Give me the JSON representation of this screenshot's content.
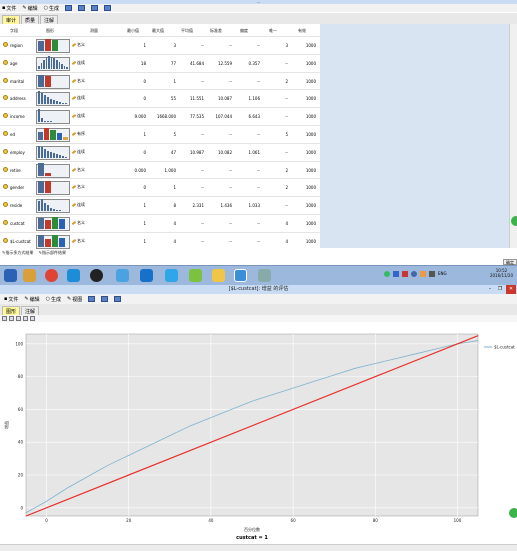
{
  "window1": {
    "title": "…",
    "menu": [
      {
        "label": "文件"
      },
      {
        "label": "编辑"
      },
      {
        "label": "生成"
      }
    ],
    "tabs": [
      {
        "label": "审计",
        "active": true
      },
      {
        "label": "质量",
        "active": false
      },
      {
        "label": "注解",
        "active": false
      }
    ],
    "columns": [
      "字段",
      "图形",
      "测量",
      "最小值",
      "最大值",
      "平均值",
      "标准差",
      "偏度",
      "唯一",
      "有效"
    ],
    "rows": [
      {
        "field": "region",
        "measure": "名义",
        "min": "1",
        "max": "3",
        "mean": "--",
        "sd": "--",
        "skew": "--",
        "unique": "3",
        "valid": "1000",
        "chart": "cat",
        "bars": [
          10,
          12,
          11
        ]
      },
      {
        "field": "age",
        "measure": "连续",
        "min": "18",
        "max": "77",
        "mean": "41.684",
        "sd": "12.559",
        "skew": "0.357",
        "unique": "--",
        "valid": "1000",
        "chart": "hist",
        "bars": [
          3,
          6,
          9,
          12,
          13,
          12,
          11,
          9,
          7,
          5,
          3,
          2
        ]
      },
      {
        "field": "marital",
        "measure": "名义",
        "min": "0",
        "max": "1",
        "mean": "--",
        "sd": "--",
        "skew": "--",
        "unique": "2",
        "valid": "1000",
        "chart": "cat",
        "bars": [
          12,
          11
        ]
      },
      {
        "field": "address",
        "measure": "连续",
        "min": "0",
        "max": "55",
        "mean": "11.551",
        "sd": "10.087",
        "skew": "1.106",
        "unique": "--",
        "valid": "1000",
        "chart": "hist",
        "bars": [
          13,
          11,
          9,
          7,
          5,
          4,
          3,
          2,
          1,
          1
        ]
      },
      {
        "field": "income",
        "measure": "连续",
        "min": "9.000",
        "max": "1668.000",
        "mean": "77.535",
        "sd": "107.044",
        "skew": "6.643",
        "unique": "--",
        "valid": "1000",
        "chart": "hist",
        "bars": [
          13,
          4,
          1,
          1,
          1
        ]
      },
      {
        "field": "ed",
        "measure": "有序",
        "min": "1",
        "max": "5",
        "mean": "--",
        "sd": "--",
        "skew": "--",
        "unique": "5",
        "valid": "1000",
        "chart": "cat",
        "bars": [
          8,
          12,
          10,
          7,
          3
        ]
      },
      {
        "field": "employ",
        "measure": "连续",
        "min": "0",
        "max": "47",
        "mean": "10.987",
        "sd": "10.082",
        "skew": "1.061",
        "unique": "--",
        "valid": "1000",
        "chart": "hist",
        "bars": [
          12,
          11,
          9,
          7,
          6,
          5,
          4,
          3,
          2,
          1
        ]
      },
      {
        "field": "retire",
        "measure": "名义",
        "min": "0.000",
        "max": "1.000",
        "mean": "--",
        "sd": "--",
        "skew": "--",
        "unique": "2",
        "valid": "1000",
        "chart": "cat",
        "bars": [
          13,
          3
        ]
      },
      {
        "field": "gender",
        "measure": "名义",
        "min": "0",
        "max": "1",
        "mean": "--",
        "sd": "--",
        "skew": "--",
        "unique": "2",
        "valid": "1000",
        "chart": "cat",
        "bars": [
          12,
          12
        ]
      },
      {
        "field": "reside",
        "measure": "连续",
        "min": "1",
        "max": "8",
        "mean": "2.331",
        "sd": "1.436",
        "skew": "1.033",
        "unique": "--",
        "valid": "1000",
        "chart": "hist",
        "bars": [
          10,
          12,
          8,
          6,
          3,
          2,
          1,
          1
        ]
      },
      {
        "field": "custcat",
        "measure": "名义",
        "min": "1",
        "max": "4",
        "mean": "--",
        "sd": "--",
        "skew": "--",
        "unique": "4",
        "valid": "1000",
        "chart": "cat",
        "bars": [
          11,
          9,
          12,
          10
        ]
      },
      {
        "field": "$L-custcat",
        "measure": "名义",
        "min": "1",
        "max": "4",
        "mean": "--",
        "sd": "--",
        "skew": "--",
        "unique": "4",
        "valid": "1000",
        "chart": "cat",
        "bars": [
          12,
          8,
          12,
          9
        ]
      }
    ],
    "footer_left": "指示多方式结果",
    "footer_right": "指示部件结果",
    "ok_label": "确定"
  },
  "taskbar": {
    "time": "10:52",
    "date": "2016/11/20",
    "lang": "ENG"
  },
  "window2": {
    "title": "[$L-custcat]: 增益 的评估",
    "menu": [
      {
        "label": "文件"
      },
      {
        "label": "编辑"
      },
      {
        "label": "生成"
      },
      {
        "label": "视图"
      }
    ],
    "tabs": [
      {
        "label": "图形",
        "active": true
      },
      {
        "label": "注解",
        "active": false
      }
    ]
  },
  "colors": {
    "gain_line": "#7fb2cf",
    "baseline": "#e8322b",
    "plot_bg": "#e6e6e6"
  },
  "chart_data": {
    "type": "line",
    "title": "",
    "xlabel": "百分位数",
    "subtitle": "custcat = 1",
    "ylabel": "增益",
    "xlim": [
      -5,
      105
    ],
    "ylim": [
      -5,
      106
    ],
    "xticks": [
      0,
      20,
      40,
      60,
      80,
      100
    ],
    "yticks": [
      0,
      20,
      40,
      60,
      80,
      100
    ],
    "series": [
      {
        "name": "$L-custcat",
        "x": [
          -5,
          0,
          5,
          10,
          15,
          20,
          25,
          30,
          35,
          40,
          45,
          50,
          55,
          60,
          65,
          70,
          75,
          80,
          85,
          90,
          95,
          100,
          105
        ],
        "y": [
          -3,
          4,
          12,
          19,
          26,
          32,
          38,
          44,
          50,
          55,
          60,
          65,
          69,
          73,
          77,
          81,
          85,
          88,
          91,
          94,
          97,
          100,
          102
        ]
      },
      {
        "name": "",
        "x": [
          -5,
          105
        ],
        "y": [
          -5,
          105
        ]
      }
    ]
  }
}
